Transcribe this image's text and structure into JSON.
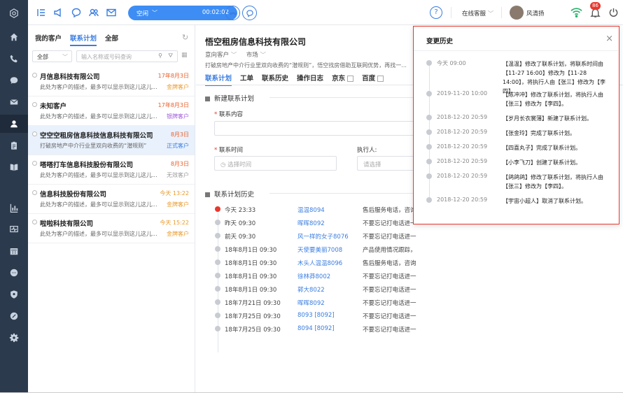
{
  "sidebar": {
    "icons": [
      "logo-icon",
      "home-icon",
      "phone-icon",
      "chat-icon",
      "mail-icon",
      "customer-icon",
      "clipboard-icon",
      "book-icon",
      "bar-chart-icon",
      "monitor-icon",
      "calendar-icon",
      "message-icon",
      "shield-icon",
      "link-icon",
      "gear-icon"
    ]
  },
  "topbar": {
    "status": "空闲",
    "timer": "00:02:02",
    "online_label": "在线客服",
    "user_name": "风清扬",
    "notification_count": "86"
  },
  "left_panel": {
    "tabs": [
      {
        "label": "我的客户"
      },
      {
        "label": "联系计划"
      },
      {
        "label": "全部"
      }
    ],
    "filter": "全部",
    "search_placeholder": "输入名称或号码查询",
    "customers": [
      {
        "name": "月信息科技有限公司",
        "date": "17年8月3日",
        "desc": "此处为客户的描述，最多可以显示到这儿这儿...",
        "level": "金牌客户",
        "level_color": "#e89a2c",
        "date_color": "#e8602c"
      },
      {
        "name": "未知客户",
        "date": "17年8月3日",
        "desc": "此处为客户的描述，最多可以显示到这儿这儿...",
        "level": "银牌客户",
        "level_color": "#a05ad8",
        "date_color": "#e8602c"
      },
      {
        "name": "空空空租房信息科技信息科技有限公司",
        "date": "8月3日",
        "desc": "打破房地产中介行业里双向收费的“潜规则”",
        "level": "正式客户",
        "level_color": "#3a7de0",
        "date_color": "#e8602c"
      },
      {
        "name": "嗒嗒打车信息科技股份有限公司",
        "date": "8月3日",
        "desc": "此处为客户的描述，最多可以显示到这儿这儿...",
        "level": "无效客户",
        "level_color": "#999999",
        "date_color": "#e8602c"
      },
      {
        "name": "信息科技股份有限公司",
        "date": "今天 13:22",
        "desc": "此处为客户的描述，最多可以显示到这儿这儿...",
        "level": "金牌客户",
        "level_color": "#e89a2c",
        "date_color": "#e89a2c"
      },
      {
        "name": "啦啦科技有限公司",
        "date": "今天 15:22",
        "desc": "此处为客户的描述，最多可以显示到这儿这儿...",
        "level": "金牌客户",
        "level_color": "#e89a2c",
        "date_color": "#e89a2c"
      }
    ]
  },
  "main": {
    "title": "悟空租房信息科技有限公司",
    "meta1": "意向客户",
    "meta2": "市场",
    "description": "打破房地产中介行业里双向收费的“潜规则”，悟空找房借助互联网优势，再找一...",
    "tabs": [
      {
        "label": "联系计划"
      },
      {
        "label": "工单"
      },
      {
        "label": "联系历史"
      },
      {
        "label": "操作日志"
      },
      {
        "label": "京东"
      },
      {
        "label": "百度"
      }
    ],
    "new_plan_title": "新建联系计划",
    "contact_content_label": "联系内容",
    "contact_time_label": "联系时间",
    "time_placeholder": "选择时间",
    "executor_label": "执行人:",
    "executor_placeholder": "请选择",
    "history_title": "联系计划历史",
    "history": [
      {
        "time": "今天  23:33",
        "name": "温温8094",
        "content": "售后服务电话，咨询"
      },
      {
        "time": "昨天  09:30",
        "name": "晖晖8092",
        "content": "不要忘记打电话进一"
      },
      {
        "time": "前天  09:30",
        "name": "风一样的女子8076",
        "content": "不要忘记打电话进一"
      },
      {
        "time": "18年8月1日  09:30",
        "name": "天使要美丽7008",
        "content": "产品使用情况跟踪，"
      },
      {
        "time": "18年8月1日  09:30",
        "name": "木头人温温8096",
        "content": "售后服务电话，咨询"
      },
      {
        "time": "18年8月1日  09:30",
        "name": "徐林莽8002",
        "content": "不要忘记打电话进一"
      },
      {
        "time": "18年8月1日  09:30",
        "name": "郭大8022",
        "content": "不要忘记打电话进一"
      },
      {
        "time": "18年7月21日  09:30",
        "name": "晖晖8092",
        "content": "不要忘记打电话进一"
      },
      {
        "time": "18年7月25日  09:30",
        "name": "8093 [8092]",
        "content": "不要忘记打电话进一"
      },
      {
        "time": "18年7月25日  09:30",
        "name": "8094 [8092]",
        "content": "不要忘记打电话进一"
      }
    ]
  },
  "change_history": {
    "title": "变更历史",
    "close": "×",
    "entries": [
      {
        "time": "今天  09:00",
        "text": "【温温】修改了联系计划，将联系时间由【11-27 16:00】修改为【11-28 14:00】，将执行人由【张三】修改为【李四】。"
      },
      {
        "time": "2019-11-20  10:00",
        "text": "【陈冲冲】修改了联系计划，将执行人由【张三】修改为【李四】。"
      },
      {
        "time": "2018-12-20  20:59",
        "text": "【岁月长衣裳薄】新建了联系计划。"
      },
      {
        "time": "2018-12-20  20:59",
        "text": "【张金玲】完成了联系计划。"
      },
      {
        "time": "2018-12-20  20:59",
        "text": "【四喜丸子】完成了联系计划。"
      },
      {
        "time": "2018-12-20  20:59",
        "text": "【小李飞刀】创建了联系计划。"
      },
      {
        "time": "2018-12-20  20:59",
        "text": "【鸽鸽鸽】修改了联系计划，将执行人由【张三】修改为【李四】。"
      },
      {
        "time": "2018-12-20  20:59",
        "text": "【宇宙小超人】取消了联系计划。"
      }
    ]
  }
}
